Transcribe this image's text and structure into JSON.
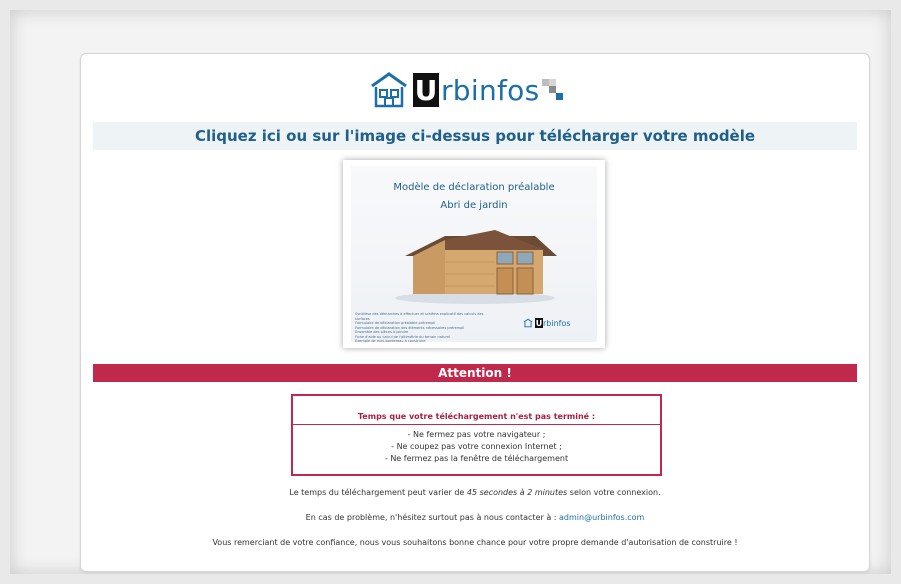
{
  "logo": {
    "text_u": "U",
    "text_rest": "rbinfos"
  },
  "headline": "Cliquez ici ou sur l'image ci-dessus pour télécharger votre modèle",
  "preview": {
    "title": "Modèle de déclaration préalable",
    "subtitle": "Abri de jardin",
    "list": [
      "Synthèse des démarches à effectuer et schéma explicatif des calculs des surfaces",
      "Formulaire de déclaration préalable prérempli",
      "Formulaire de déclaration des éléments nécessaires prérempli",
      "Ensemble des pièces à joindre",
      "Fiche d'aide au calcul de l'altimétrie du terrain naturel",
      "Exemple de mini-bordereau à construire"
    ],
    "logo_u": "U",
    "logo_rest": "rbinfos"
  },
  "attention": "Attention !",
  "warning": {
    "title": "Temps que votre téléchargement n'est pas terminé :",
    "items": [
      "- Ne fermez pas votre navigateur ;",
      "- Ne coupez pas votre connexion Internet ;",
      "- Ne fermez pas la fenêtre de téléchargement"
    ]
  },
  "info": {
    "time_before": "Le temps du téléchargement peut varier de ",
    "time_em": "45 secondes à 2 minutes",
    "time_after": " selon votre connexion.",
    "contact_before": "En cas de problème, n'hésitez surtout pas à nous contacter à : ",
    "contact_email": "admin@urbinfos.com",
    "thanks": "Vous remerciant de votre confiance, nous vous souhaitons bonne chance pour votre propre demande d'autorisation de construire !"
  },
  "colors": {
    "accent": "#c0294b",
    "brand_blue": "#1d6fa8",
    "heading_blue": "#1f5f8c"
  }
}
